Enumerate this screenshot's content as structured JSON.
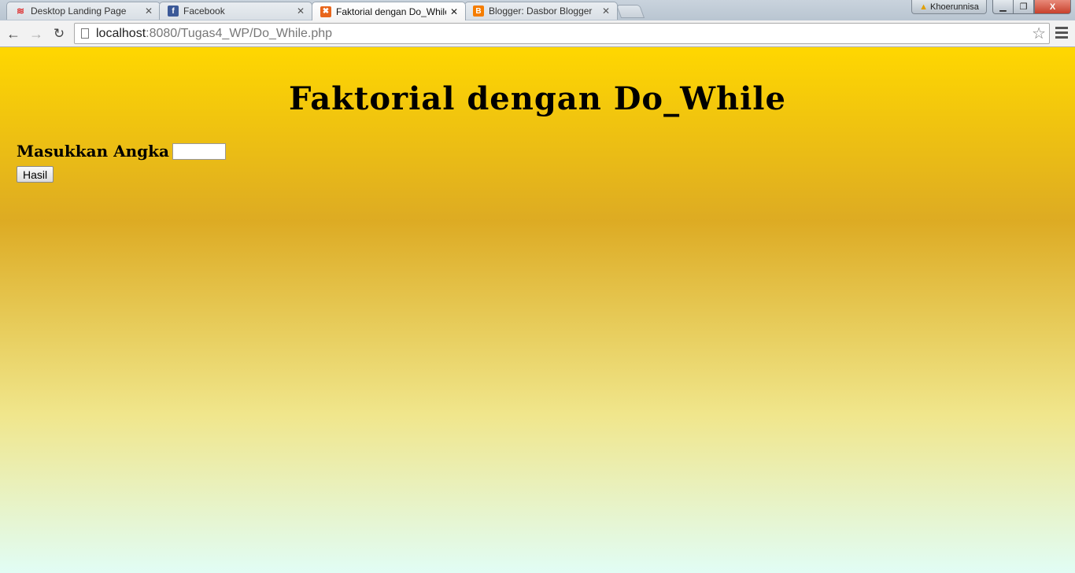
{
  "browser": {
    "tabs": [
      {
        "label": "Desktop Landing Page",
        "icon": "wifi-icon",
        "active": false
      },
      {
        "label": "Facebook",
        "icon": "facebook-icon",
        "active": false
      },
      {
        "label": "Faktorial dengan Do_While",
        "icon": "xampp-icon",
        "active": true
      },
      {
        "label": "Blogger: Dasbor Blogger",
        "icon": "blogger-icon",
        "active": false
      }
    ],
    "profile_name": "Khoerunnisa",
    "url_host": "localhost",
    "url_path": ":8080/Tugas4_WP/Do_While.php",
    "window_buttons": {
      "minimize": "▁",
      "maximize": "❐",
      "close": "X"
    }
  },
  "page": {
    "title": "Faktorial dengan Do_While",
    "input_label": "Masukkan Angka",
    "input_value": "",
    "submit_label": "Hasil"
  },
  "colors": {
    "gradient_top": "#ffd700",
    "gradient_mid": "#ddab23",
    "gradient_bottom": "#e1fdf5"
  }
}
